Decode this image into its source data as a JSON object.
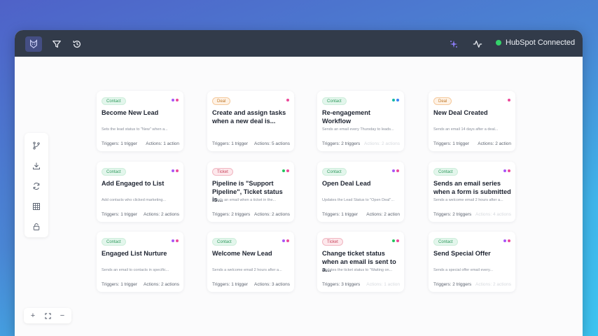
{
  "header": {
    "status_text": "HubSpot Connected",
    "status_color": "#34d36a",
    "icons": [
      "app-logo-icon",
      "filter-icon",
      "history-icon",
      "ai-sparkle-icon",
      "activity-icon"
    ]
  },
  "side_toolbar": {
    "icons": [
      "branch-icon",
      "download-icon",
      "refresh-icon",
      "grid-icon",
      "lock-icon"
    ]
  },
  "zoom": {
    "in": "+",
    "out": "−",
    "fit_icon": "fit-screen-icon"
  },
  "colors": {
    "contact": "#2f9a5d",
    "deal": "#c07a2c",
    "ticket": "#c8455c",
    "dot_purple": "#a855f7",
    "dot_pink": "#ec4899",
    "dot_blue": "#3b82f6",
    "dot_green": "#22c55e",
    "dot_teal": "#14b8a6"
  },
  "cards": [
    {
      "badge": "Contact",
      "type": "contact",
      "title": "Become New Lead",
      "desc": "Sets the lead status to \"New\" when a...",
      "triggers": "Triggers: 1 trigger",
      "actions": "Actions: 1 action",
      "dots": [
        "#a855f7",
        "#ec4899"
      ],
      "faded": false
    },
    {
      "badge": "Deal",
      "type": "deal",
      "title": "Create and assign tasks when a new deal is...",
      "desc": "",
      "triggers": "Triggers: 1 trigger",
      "actions": "Actions: 5 actions",
      "dots": [
        "#ec4899"
      ],
      "faded": false
    },
    {
      "badge": "Contact",
      "type": "contact",
      "title": "Re-engagement Workflow",
      "desc": "Sends an email every Thursday to leads...",
      "triggers": "Triggers: 2 triggers",
      "actions": "Actions: 2 actions",
      "dots": [
        "#14b8a6",
        "#3b82f6"
      ],
      "faded": true
    },
    {
      "badge": "Deal",
      "type": "deal",
      "title": "New Deal Created",
      "desc": "Sends an email 14 days after a deal...",
      "triggers": "Triggers: 1 trigger",
      "actions": "Actions: 2 action",
      "dots": [
        "#ec4899"
      ],
      "faded": false
    },
    {
      "badge": "Contact",
      "type": "contact",
      "title": "Add Engaged to List",
      "desc": "Add contacts who clicked marketing...",
      "triggers": "Triggers: 1 trigger",
      "actions": "Actions: 2 actions",
      "dots": [
        "#a855f7",
        "#ec4899"
      ],
      "faded": false
    },
    {
      "badge": "Ticket",
      "type": "ticket",
      "title": "Pipeline is \"Support Pipeline\", Ticket status is...",
      "desc": "Sends an email when a ticket in the...",
      "triggers": "Triggers: 2 triggers",
      "actions": "Actions: 2 actions",
      "dots": [
        "#22c55e",
        "#ec4899"
      ],
      "faded": false
    },
    {
      "badge": "Contact",
      "type": "contact",
      "title": "Open Deal Lead",
      "desc": "Updates the Lead Status to \"Open Deal\"...",
      "triggers": "Triggers: 1 trigger",
      "actions": "Actions: 2 action",
      "dots": [
        "#a855f7",
        "#ec4899"
      ],
      "faded": false
    },
    {
      "badge": "Contact",
      "type": "contact",
      "title": "Sends an email series when a form is submitted",
      "desc": "Sends a welcome email 2 hours after a...",
      "triggers": "Triggers: 2 triggers",
      "actions": "Actions: 4 actions",
      "dots": [
        "#a855f7",
        "#ec4899"
      ],
      "faded": true
    },
    {
      "badge": "Contact",
      "type": "contact",
      "title": "Engaged List Nurture",
      "desc": "Sends an email to contacts in specific...",
      "triggers": "Triggers: 1 trigger",
      "actions": "Actions: 2 actions",
      "dots": [
        "#a855f7",
        "#ec4899"
      ],
      "faded": false
    },
    {
      "badge": "Contact",
      "type": "contact",
      "title": "Welcome New Lead",
      "desc": "Sends a welcome email 2 hours after a...",
      "triggers": "Triggers: 1 trigger",
      "actions": "Actions: 3 actions",
      "dots": [
        "#a855f7",
        "#ec4899"
      ],
      "faded": false
    },
    {
      "badge": "Ticket",
      "type": "ticket",
      "title": "Change ticket status when an email is sent to a...",
      "desc": "Updates the ticket status to \"Waiting on...",
      "triggers": "Triggers: 3 triggers",
      "actions": "Actions: 1 action",
      "dots": [
        "#22c55e",
        "#ec4899"
      ],
      "faded": true
    },
    {
      "badge": "Contact",
      "type": "contact",
      "title": "Send Special Offer",
      "desc": "Sends a special offer email every...",
      "triggers": "Triggers: 2 triggers",
      "actions": "Actions: 2 actions",
      "dots": [
        "#a855f7",
        "#ec4899"
      ],
      "faded": true
    }
  ]
}
